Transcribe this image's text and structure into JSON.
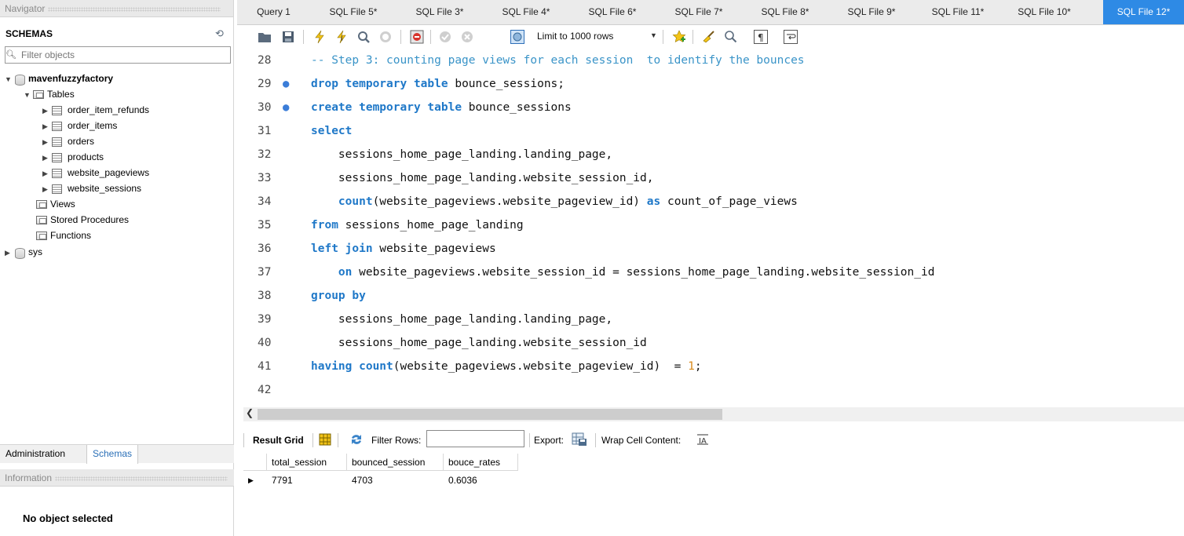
{
  "navigator": {
    "title": "Navigator",
    "schemas_label": "SCHEMAS",
    "filter_placeholder": "Filter objects",
    "schema": "mavenfuzzyfactory",
    "tables_label": "Tables",
    "tables": [
      "order_item_refunds",
      "order_items",
      "orders",
      "products",
      "website_pageviews",
      "website_sessions"
    ],
    "views_label": "Views",
    "procs_label": "Stored Procedures",
    "functions_label": "Functions",
    "sys_schema": "sys",
    "bottom_tabs": [
      "Administration",
      "Schemas"
    ],
    "info_title": "Information",
    "no_object": "No object selected"
  },
  "tabs": [
    "Query 1",
    "SQL File 5*",
    "SQL File 3*",
    "SQL File 4*",
    "SQL File 6*",
    "SQL File 7*",
    "SQL File 8*",
    "SQL File 9*",
    "SQL File 11*",
    "SQL File 10*",
    "SQL File 12*"
  ],
  "active_tab": "SQL File 12*",
  "toolbar": {
    "limit": "Limit to 1000 rows"
  },
  "editor": {
    "lines": [
      {
        "num": "28",
        "dot": false,
        "parts": [
          [
            "cm",
            "-- Step 3: counting page views for each session  to identify the bounces"
          ]
        ]
      },
      {
        "num": "29",
        "dot": true,
        "parts": [
          [
            "kw",
            "drop temporary table"
          ],
          [
            "",
            " bounce_sessions;"
          ]
        ]
      },
      {
        "num": "30",
        "dot": true,
        "parts": [
          [
            "kw",
            "create temporary table"
          ],
          [
            "",
            " bounce_sessions"
          ]
        ]
      },
      {
        "num": "31",
        "dot": false,
        "parts": [
          [
            "kw",
            "select"
          ]
        ]
      },
      {
        "num": "32",
        "dot": false,
        "parts": [
          [
            "",
            "    sessions_home_page_landing.landing_page,"
          ]
        ]
      },
      {
        "num": "33",
        "dot": false,
        "parts": [
          [
            "",
            "    sessions_home_page_landing.website_session_id,"
          ]
        ]
      },
      {
        "num": "34",
        "dot": false,
        "parts": [
          [
            "",
            "    "
          ],
          [
            "kw",
            "count"
          ],
          [
            "",
            "(website_pageviews.website_pageview_id) "
          ],
          [
            "kw",
            "as"
          ],
          [
            "",
            " count_of_page_views"
          ]
        ]
      },
      {
        "num": "35",
        "dot": false,
        "parts": [
          [
            "kw",
            "from"
          ],
          [
            "",
            " sessions_home_page_landing"
          ]
        ]
      },
      {
        "num": "36",
        "dot": false,
        "parts": [
          [
            "kw",
            "left join"
          ],
          [
            "",
            " website_pageviews"
          ]
        ]
      },
      {
        "num": "37",
        "dot": false,
        "parts": [
          [
            "",
            "    "
          ],
          [
            "kw",
            "on"
          ],
          [
            "",
            " website_pageviews.website_session_id = sessions_home_page_landing.website_session_id"
          ]
        ]
      },
      {
        "num": "38",
        "dot": false,
        "parts": [
          [
            "kw",
            "group by"
          ]
        ]
      },
      {
        "num": "39",
        "dot": false,
        "parts": [
          [
            "",
            "    sessions_home_page_landing.landing_page,"
          ]
        ]
      },
      {
        "num": "40",
        "dot": false,
        "parts": [
          [
            "",
            "    sessions_home_page_landing.website_session_id"
          ]
        ]
      },
      {
        "num": "41",
        "dot": false,
        "parts": [
          [
            "kw",
            "having count"
          ],
          [
            "",
            "(website_pageviews.website_pageview_id)  = "
          ],
          [
            "nm",
            "1"
          ],
          [
            "",
            ";"
          ]
        ]
      },
      {
        "num": "42",
        "dot": false,
        "parts": []
      }
    ]
  },
  "result_bar": {
    "result_grid": "Result Grid",
    "filter_rows": "Filter Rows:",
    "export": "Export:",
    "wrap": "Wrap Cell Content:"
  },
  "grid": {
    "columns": [
      "total_session",
      "bounced_session",
      "bouce_rates"
    ],
    "rows": [
      [
        "7791",
        "4703",
        "0.6036"
      ]
    ]
  }
}
